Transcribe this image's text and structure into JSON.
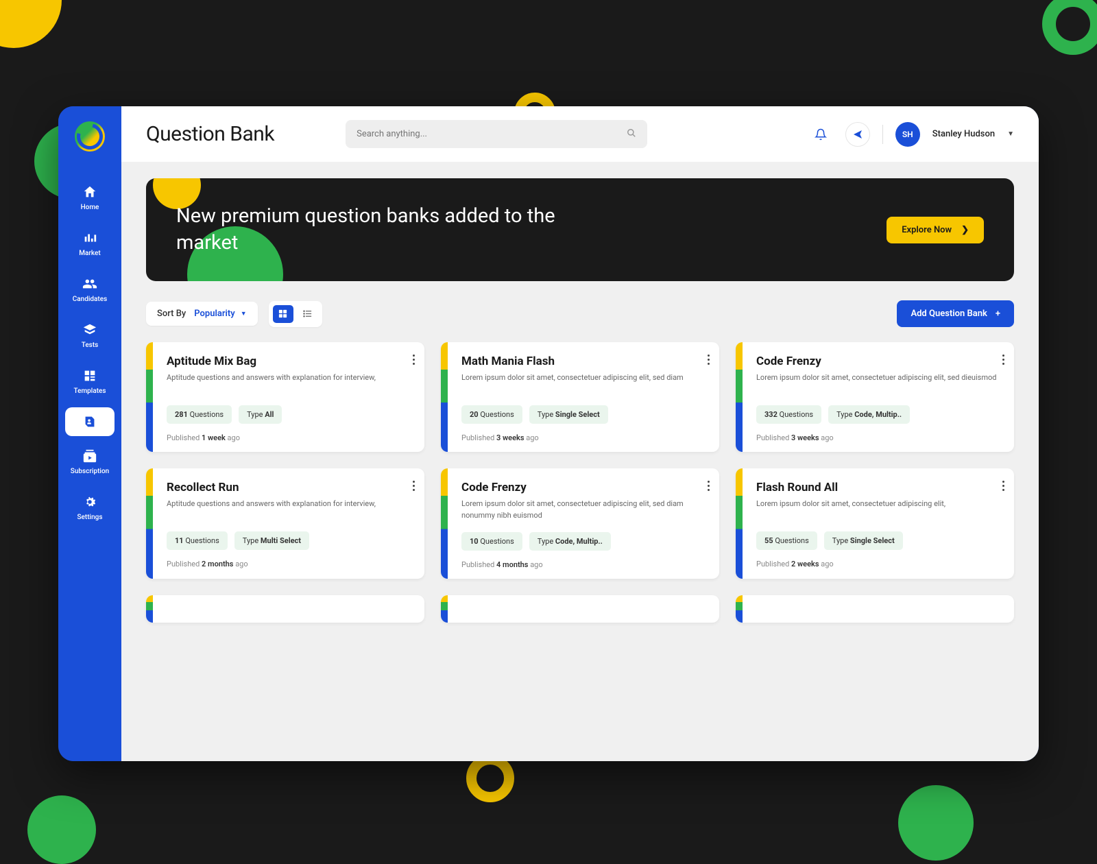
{
  "header": {
    "title": "Question Bank",
    "search_placeholder": "Search anything...",
    "user_initials": "SH",
    "user_name": "Stanley Hudson"
  },
  "sidebar": {
    "items": [
      {
        "label": "Home",
        "icon": "home"
      },
      {
        "label": "Market",
        "icon": "market"
      },
      {
        "label": "Candidates",
        "icon": "candidates"
      },
      {
        "label": "Tests",
        "icon": "tests"
      },
      {
        "label": "Templates",
        "icon": "templates"
      },
      {
        "label": "",
        "icon": "qbank"
      },
      {
        "label": "Subscription",
        "icon": "subscription"
      },
      {
        "label": "Settings",
        "icon": "settings"
      }
    ]
  },
  "banner": {
    "text": "New premium question banks added to the market",
    "cta": "Explore Now"
  },
  "toolbar": {
    "sort_label": "Sort By",
    "sort_value": "Popularity",
    "add_label": "Add Question Bank"
  },
  "cards": [
    {
      "title": "Aptitude Mix Bag",
      "desc": "Aptitude questions and answers with explanation for interview,",
      "q_count": "281",
      "q_label": " Questions",
      "type_label": "Type ",
      "type_value": "All",
      "pub_label": "Published  ",
      "pub_value": "1 week",
      "pub_suffix": " ago"
    },
    {
      "title": "Math Mania Flash",
      "desc": "Lorem ipsum dolor sit amet, consectetuer adipiscing elit, sed diam",
      "q_count": "20",
      "q_label": " Questions",
      "type_label": "Type ",
      "type_value": "Single Select",
      "pub_label": "Published  ",
      "pub_value": "3 weeks",
      "pub_suffix": " ago"
    },
    {
      "title": "Code Frenzy",
      "desc": "Lorem ipsum dolor sit amet, consectetuer adipiscing elit, sed dieuismod",
      "q_count": "332",
      "q_label": " Questions",
      "type_label": "Type ",
      "type_value": "Code, Multip..",
      "pub_label": "Published  ",
      "pub_value": "3 weeks",
      "pub_suffix": " ago"
    },
    {
      "title": "Recollect Run",
      "desc": "Aptitude questions and answers with explanation for interview,",
      "q_count": "11",
      "q_label": " Questions",
      "type_label": "Type ",
      "type_value": "Multi Select",
      "pub_label": "Published  ",
      "pub_value": "2 months",
      "pub_suffix": " ago"
    },
    {
      "title": "Code Frenzy",
      "desc": "Lorem ipsum dolor sit amet, consectetuer adipiscing elit, sed diam nonummy nibh euismod",
      "q_count": "10",
      "q_label": " Questions",
      "type_label": "Type ",
      "type_value": "Code, Multip..",
      "pub_label": "Published  ",
      "pub_value": "4 months",
      "pub_suffix": " ago"
    },
    {
      "title": "Flash Round All",
      "desc": "Lorem ipsum dolor sit amet, consectetuer adipiscing elit,",
      "q_count": "55",
      "q_label": " Questions",
      "type_label": "Type ",
      "type_value": "Single Select",
      "pub_label": "Published  ",
      "pub_value": "2 weeks",
      "pub_suffix": " ago"
    }
  ]
}
